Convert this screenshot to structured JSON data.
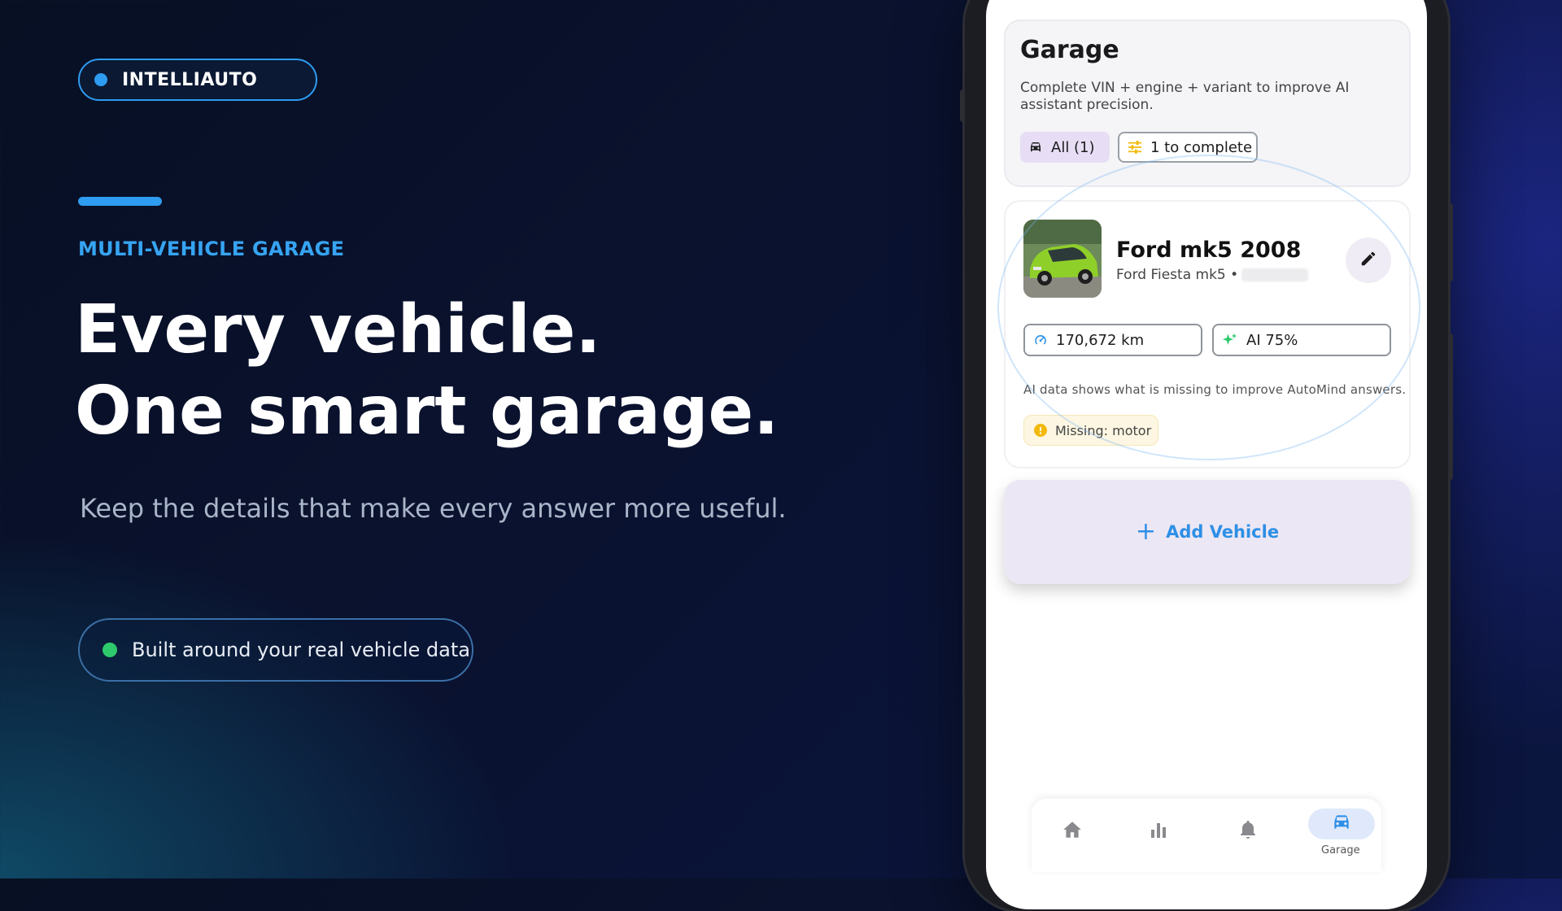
{
  "brand": {
    "name": "INTELLIAUTO",
    "accent": "#2e9cf0"
  },
  "hero": {
    "eyebrow": "MULTI-VEHICLE GARAGE",
    "headline_line1": "Every vehicle.",
    "headline_line2": "One smart garage.",
    "subcopy": "Keep the details that make every answer more useful.",
    "feature": "Built around your real vehicle data"
  },
  "app": {
    "garage": {
      "title": "Garage",
      "description": "Complete VIN + engine + variant to improve AI assistant precision.",
      "filters": [
        {
          "label": "All (1)",
          "icon": "car-icon"
        },
        {
          "label": "1 to complete",
          "icon": "sliders-icon"
        }
      ]
    },
    "vehicle": {
      "name": "Ford mk5 2008",
      "subtitle": "Ford Fiesta mk5 •",
      "mileage": "170,672 km",
      "ai_score": "AI 75%",
      "ai_note": "AI data shows what is missing to improve AutoMind answers.",
      "missing": "Missing: motor"
    },
    "add_vehicle": "Add Vehicle",
    "nav": {
      "items": [
        "home-icon",
        "stats-icon",
        "bell-icon",
        "car-icon"
      ],
      "active_label": "Garage"
    }
  },
  "colors": {
    "status_ok": "#2ec96b",
    "warning": "#f2b90c",
    "link": "#2e8fe6"
  }
}
